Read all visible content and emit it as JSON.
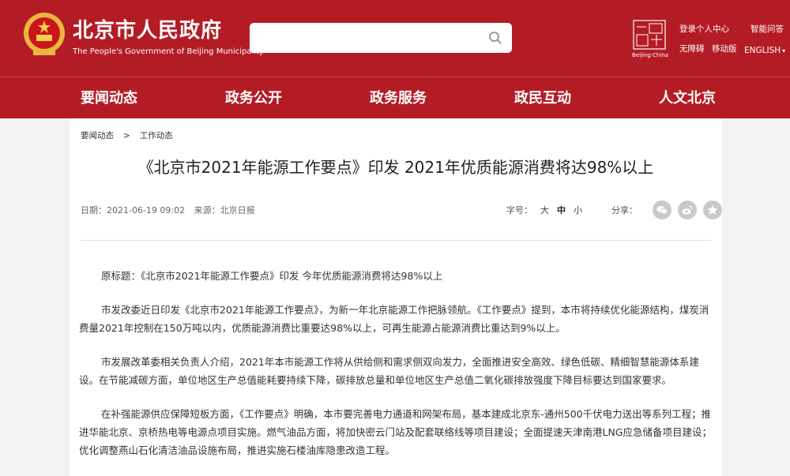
{
  "header": {
    "site_title": "北京市人民政府",
    "site_subtitle": "The People's Government of Beijing Municipality",
    "search": {
      "value": "",
      "placeholder": ""
    },
    "logo_text": "Beijing·China",
    "links": {
      "login": "登录个人中心",
      "qa": "智能问答",
      "accessible": "无障碍",
      "mobile": "移动版",
      "english": "ENGLISH"
    },
    "colors": {
      "brand": "#b41c25"
    }
  },
  "nav": [
    "要闻动态",
    "政务公开",
    "政务服务",
    "政民互动",
    "人文北京"
  ],
  "breadcrumb": [
    "要闻动态",
    "工作动态"
  ],
  "breadcrumb_separator": ">",
  "article": {
    "title": "《北京市2021年能源工作要点》印发 2021年优质能源消费将达98%以上",
    "date": "日期：2021-06-19 09:02",
    "source": "来源：北京日报",
    "font_size_label": "字号：",
    "font_sizes": [
      "大",
      "中",
      "小"
    ],
    "share_label": "分享：",
    "paragraphs": [
      "原标题：《北京市2021年能源工作要点》印发 今年优质能源消费将达98%以上",
      "市发改委近日印发《北京市2021年能源工作要点》，为新一年北京能源工作把脉领航。《工作要点》提到，本市将持续优化能源结构，煤炭消费量2021年控制在150万吨以内，优质能源消费比重要达98%以上，可再生能源占能源消费比重达到9%以上。",
      "市发展改革委相关负责人介绍，2021年本市能源工作将从供给侧和需求侧双向发力，全面推进安全高效、绿色低碳、精细智慧能源体系建设。在节能减碳方面，单位地区生产总值能耗要持续下降，碳排放总量和单位地区生产总值二氧化碳排放强度下降目标要达到国家要求。",
      "在补强能源供应保障短板方面，《工作要点》明确，本市要完善电力通道和网架布局，基本建成北京东-通州500千伏电力送出等系列工程；推进华能北京、京桥热电等电源点项目实施。燃气油品方面，将加快密云门站及配套联络线等项目建设；全面提速天津南港LNG应急储备项目建设；优化调整燕山石化清洁油品设施布局，推进实施石楼油库隐患改造工程。"
    ]
  }
}
